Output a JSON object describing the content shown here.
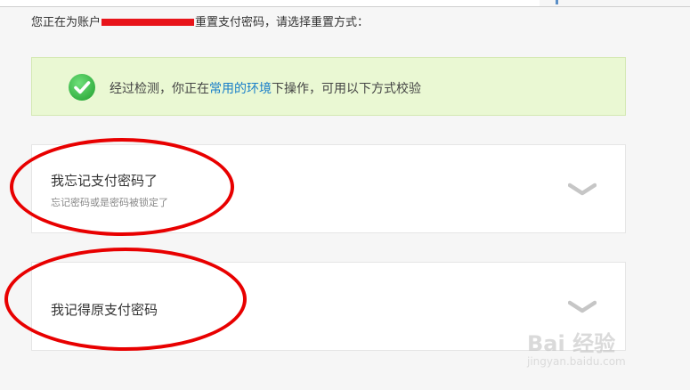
{
  "intro": {
    "prefix": "您正在为账户",
    "suffix": "重置支付密码，请选择重置方式："
  },
  "notice": {
    "text_before": "经过检测，你正在",
    "link_text": "常用的环境",
    "text_after": "下操作，可用以下方式校验",
    "icon": "check-circle-icon",
    "colors": {
      "background": "#eaf8d3",
      "link": "#1a7fc9",
      "check": "#2fb53f"
    }
  },
  "options": [
    {
      "title": "我忘记支付密码了",
      "subtitle": "忘记密码或是密码被锁定了",
      "icon": "chevron-down-icon"
    },
    {
      "title": "我记得原支付密码",
      "icon": "chevron-down-icon"
    }
  ],
  "annotation": {
    "color": "#e80000"
  },
  "watermark": {
    "brand": "Bai 经验",
    "url": "jingyan.baidu.com"
  }
}
